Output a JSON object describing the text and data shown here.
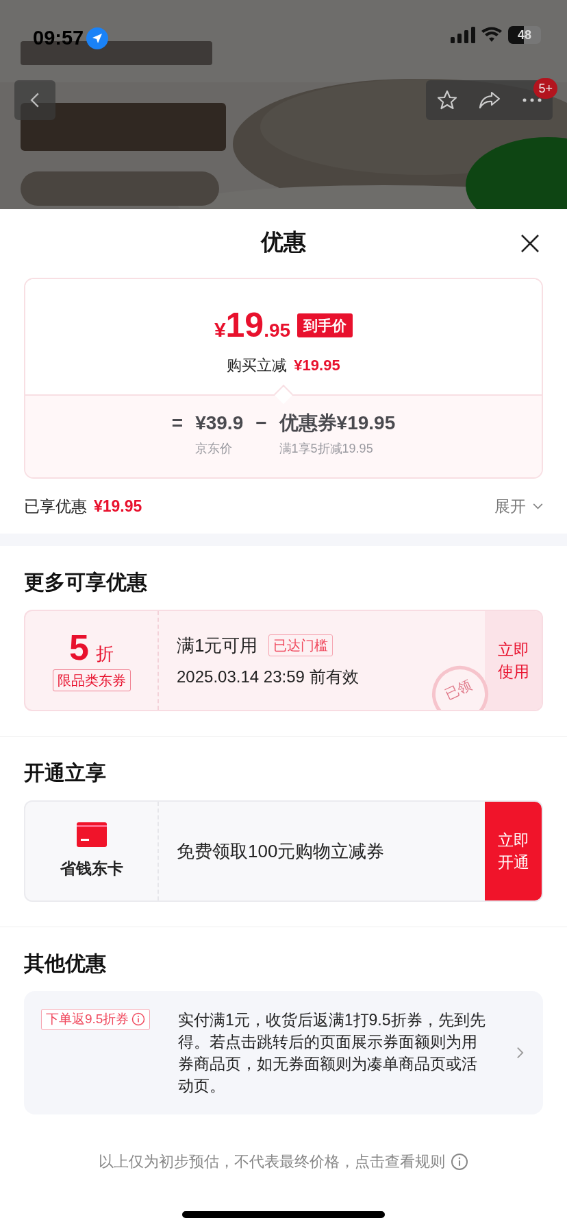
{
  "status_bar": {
    "time": "09:57",
    "battery": "48"
  },
  "nav": {
    "badge": "5+"
  },
  "sheet": {
    "title": "优惠"
  },
  "price_card": {
    "currency": "¥",
    "integer": "19",
    "decimal": ".95",
    "price_tag": "到手价",
    "instant_label": "购买立减",
    "instant_amount": "¥19.95",
    "equation": [
      {
        "kind": "symbol",
        "text": "="
      },
      {
        "kind": "term",
        "value": "¥39.9",
        "caption": "京东价"
      },
      {
        "kind": "symbol",
        "text": "−"
      },
      {
        "kind": "term",
        "value": "优惠券¥19.95",
        "caption": "满1享5折减19.95"
      }
    ]
  },
  "enjoyed": {
    "label": "已享优惠",
    "amount": "¥19.95",
    "expand": "展开"
  },
  "sections": [
    {
      "kind": "coupon",
      "title": "更多可享优惠",
      "discount": "5",
      "unit": "折",
      "tag": "限品类东券",
      "condition": "满1元可用",
      "badge": "已达门槛",
      "validity": "2025.03.14 23:59 前有效",
      "stamp": "已领",
      "action": "立即使用"
    },
    {
      "kind": "membership",
      "title": "开通立享",
      "card_name": "省钱东卡",
      "offer": "免费领取100元购物立减券",
      "action": "立即开通"
    },
    {
      "kind": "rebate",
      "title": "其他优惠",
      "tag": "下单返9.5折券",
      "text": "实付满1元，收货后返满1打9.5折券，先到先得。若点击跳转后的页面展示券面额则为用券商品页，如无券面额则为凑单商品页或活动页。"
    }
  ],
  "footer": "以上仅为初步预估，不代表最终价格，点击查看规则"
}
